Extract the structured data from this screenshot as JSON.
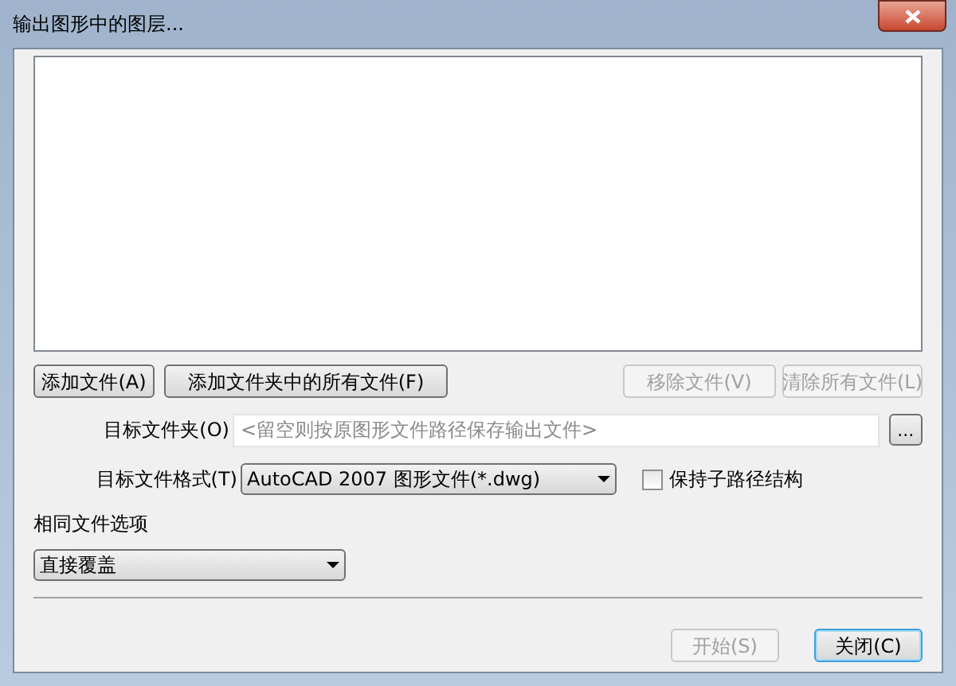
{
  "window": {
    "title": "输出图形中的图层..."
  },
  "file_buttons_left": [
    {
      "label": "添加文件(A)",
      "disabled": false
    },
    {
      "label": "添加文件夹中的所有文件(F)",
      "disabled": false
    }
  ],
  "file_buttons_right": [
    {
      "label": "移除文件(V)",
      "disabled": true
    },
    {
      "label": "清除所有文件(L)",
      "disabled": true
    }
  ],
  "target_folder": {
    "label": "目标文件夹(O)",
    "placeholder": "<留空则按原图形文件路径保存输出文件>",
    "browse_button": "..."
  },
  "target_format": {
    "label": "目标文件格式(T)",
    "value": "AutoCAD 2007 图形文件(*.dwg)"
  },
  "keep_subpath": {
    "label": "保持子路径结构",
    "checked": false
  },
  "same_file_options": {
    "label": "相同文件选项",
    "value": "直接覆盖"
  },
  "dialog_buttons": [
    {
      "label": "开始(S)",
      "disabled": true,
      "default": false
    },
    {
      "label": "关闭(C)",
      "disabled": false,
      "default": true
    }
  ]
}
